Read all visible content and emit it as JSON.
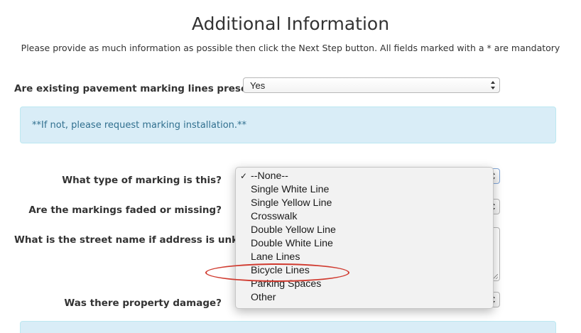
{
  "header": {
    "title": "Additional Information",
    "instructions": "Please provide as much information as possible then click the Next Step button. All fields marked with a * are mandatory"
  },
  "questions": {
    "lines_present": {
      "label": "Are existing pavement marking lines present?",
      "value": "Yes"
    },
    "info_message": "**If not, please request marking installation.**",
    "marking_type": {
      "label": "What type of marking is this?"
    },
    "faded_or_missing": {
      "label": "Are the markings faded or missing?"
    },
    "street_name": {
      "label": "What is the street name if address is unknown?"
    },
    "property_damage": {
      "label": "Was there property damage?"
    }
  },
  "dropdown": {
    "check_glyph": "✓",
    "options": [
      "--None--",
      "Single White Line",
      "Single Yellow Line",
      "Crosswalk",
      "Double Yellow Line",
      "Double White Line",
      "Lane Lines",
      "Bicycle Lines",
      "Parking Spaces",
      "Other"
    ],
    "selected_index": 0,
    "highlighted_option": "Bicycle Lines"
  },
  "colors": {
    "info_background": "#d9edf7",
    "info_text": "#31708f",
    "annotation_ellipse": "#d03a2f"
  }
}
